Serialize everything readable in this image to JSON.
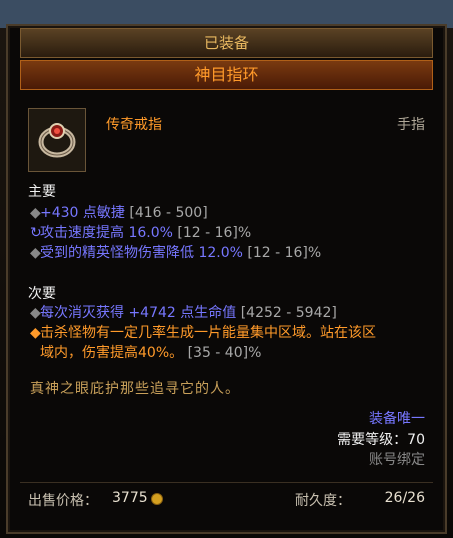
{
  "header": {
    "equipped": "已装备",
    "item_name": "神目指环"
  },
  "item": {
    "subtitle": "传奇戒指",
    "slot": "手指"
  },
  "primary": {
    "title": "主要",
    "lines": [
      {
        "value": "+430 点敏捷",
        "range": "[416 - 500]"
      },
      {
        "value": "攻击速度提高 16.0%",
        "range": "[12 - 16]%"
      },
      {
        "value": "受到的精英怪物伤害降低 12.0%",
        "range": "[12 - 16]%"
      }
    ]
  },
  "secondary": {
    "title": "次要",
    "lines": [
      {
        "value": "每次消灭获得 +4742 点生命值",
        "range": "[4252 - 5942]"
      },
      {
        "value_a": "击杀怪物有一定几率生成一片能量集中区域。站在该区",
        "value_b": "域内，伤害提高40%。",
        "range": "[35 - 40]%"
      }
    ]
  },
  "flavor": "真神之眼庇护那些追寻它的人。",
  "requirements": {
    "unique": "装备唯一",
    "level": "需要等级：70",
    "bound": "账号绑定"
  },
  "footer": {
    "price_label": "出售价格：",
    "price": "3775",
    "durability_label": "耐久度：",
    "durability": "26/26"
  },
  "colors": {
    "legendary": "#ff9a2a",
    "magic": "#7777ff",
    "range": "#a8a8a8",
    "flavor": "#c8a05a"
  }
}
